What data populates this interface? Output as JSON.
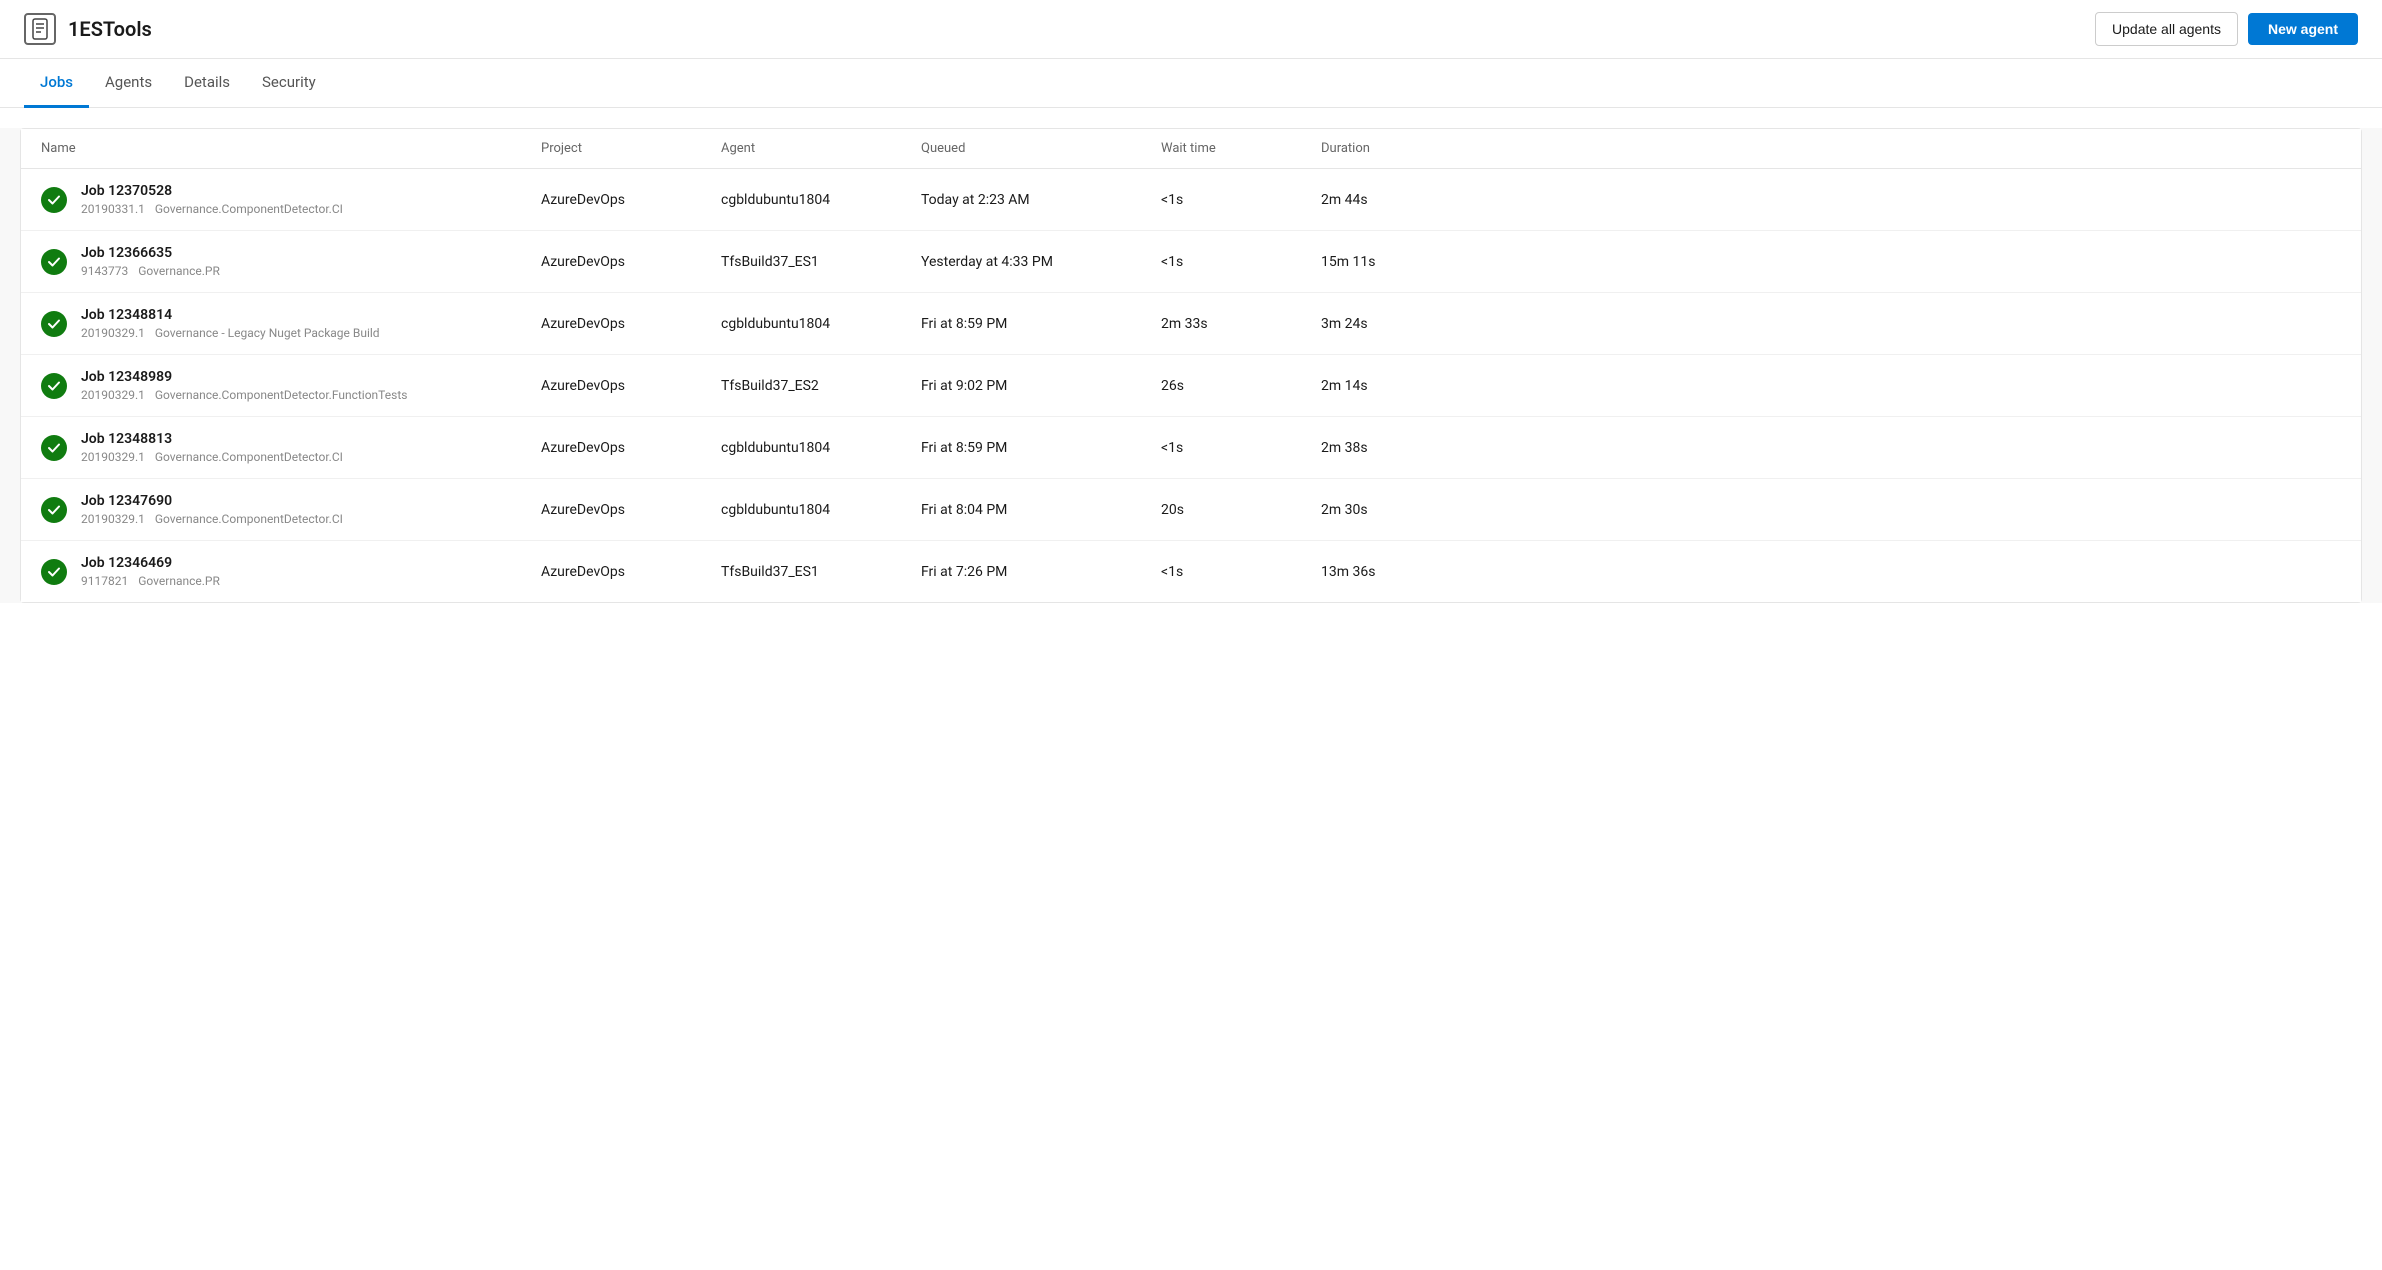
{
  "header": {
    "app_icon": "📱",
    "app_title": "1ESTools",
    "update_all_label": "Update all agents",
    "new_agent_label": "New agent"
  },
  "nav": {
    "tabs": [
      {
        "id": "jobs",
        "label": "Jobs",
        "active": true
      },
      {
        "id": "agents",
        "label": "Agents",
        "active": false
      },
      {
        "id": "details",
        "label": "Details",
        "active": false
      },
      {
        "id": "security",
        "label": "Security",
        "active": false
      }
    ]
  },
  "table": {
    "columns": [
      {
        "id": "name",
        "label": "Name"
      },
      {
        "id": "project",
        "label": "Project"
      },
      {
        "id": "agent",
        "label": "Agent"
      },
      {
        "id": "queued",
        "label": "Queued"
      },
      {
        "id": "wait_time",
        "label": "Wait time"
      },
      {
        "id": "duration",
        "label": "Duration"
      }
    ],
    "rows": [
      {
        "id": "row1",
        "status": "success",
        "job_name": "Job 12370528",
        "job_id": "20190331.1",
        "job_pipeline": "Governance.ComponentDetector.CI",
        "project": "AzureDevOps",
        "agent": "cgbldubuntu1804",
        "queued": "Today at 2:23 AM",
        "wait_time": "<1s",
        "duration": "2m 44s"
      },
      {
        "id": "row2",
        "status": "success",
        "job_name": "Job 12366635",
        "job_id": "9143773",
        "job_pipeline": "Governance.PR",
        "project": "AzureDevOps",
        "agent": "TfsBuild37_ES1",
        "queued": "Yesterday at 4:33 PM",
        "wait_time": "<1s",
        "duration": "15m 11s"
      },
      {
        "id": "row3",
        "status": "success",
        "job_name": "Job 12348814",
        "job_id": "20190329.1",
        "job_pipeline": "Governance - Legacy Nuget Package Build",
        "project": "AzureDevOps",
        "agent": "cgbldubuntu1804",
        "queued": "Fri at 8:59 PM",
        "wait_time": "2m 33s",
        "duration": "3m 24s"
      },
      {
        "id": "row4",
        "status": "success",
        "job_name": "Job 12348989",
        "job_id": "20190329.1",
        "job_pipeline": "Governance.ComponentDetector.FunctionTests",
        "project": "AzureDevOps",
        "agent": "TfsBuild37_ES2",
        "queued": "Fri at 9:02 PM",
        "wait_time": "26s",
        "duration": "2m 14s"
      },
      {
        "id": "row5",
        "status": "success",
        "job_name": "Job 12348813",
        "job_id": "20190329.1",
        "job_pipeline": "Governance.ComponentDetector.CI",
        "project": "AzureDevOps",
        "agent": "cgbldubuntu1804",
        "queued": "Fri at 8:59 PM",
        "wait_time": "<1s",
        "duration": "2m 38s"
      },
      {
        "id": "row6",
        "status": "success",
        "job_name": "Job 12347690",
        "job_id": "20190329.1",
        "job_pipeline": "Governance.ComponentDetector.CI",
        "project": "AzureDevOps",
        "agent": "cgbldubuntu1804",
        "queued": "Fri at 8:04 PM",
        "wait_time": "20s",
        "duration": "2m 30s"
      },
      {
        "id": "row7",
        "status": "success",
        "job_name": "Job 12346469",
        "job_id": "9117821",
        "job_pipeline": "Governance.PR",
        "project": "AzureDevOps",
        "agent": "TfsBuild37_ES1",
        "queued": "Fri at 7:26 PM",
        "wait_time": "<1s",
        "duration": "13m 36s"
      }
    ]
  }
}
